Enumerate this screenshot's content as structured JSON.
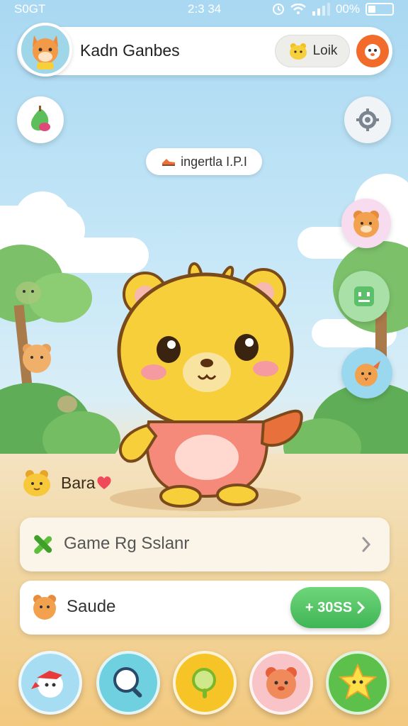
{
  "status_bar": {
    "carrier": "S0GT",
    "time": "2:3 34",
    "battery": "00%"
  },
  "profile": {
    "name": "Kadn Ganbes",
    "look_label": "Loik"
  },
  "level_pill": {
    "text": "ingertla I.P.I"
  },
  "pet": {
    "name": "Bara"
  },
  "cards": {
    "game_label": "Game Rg Sslanr",
    "shop_label": "Saude",
    "coins_label": "+ 30SS"
  },
  "colors": {
    "sky": "#a9d8f2",
    "sand": "#f3cf8c",
    "accent_orange": "#f26b2a",
    "accent_green": "#3fb556",
    "character_yellow": "#f7cf3a"
  },
  "icons": {
    "avatar": "fox-avatar-icon",
    "look": "yellow-critter-icon",
    "orange": "orange-face-icon",
    "left_top": "green-pear-icon",
    "right_top": "gear-icon",
    "level": "sneaker-icon",
    "side_1": "bear-pet-icon",
    "side_2": "green-robot-icon",
    "side_3": "orange-bird-icon",
    "game": "green-cross-icon",
    "nav_1": "red-bird-icon",
    "nav_2": "magnifier-icon",
    "nav_3": "green-magnifier-icon",
    "nav_4": "pink-pet-icon",
    "nav_5": "star-icon"
  }
}
